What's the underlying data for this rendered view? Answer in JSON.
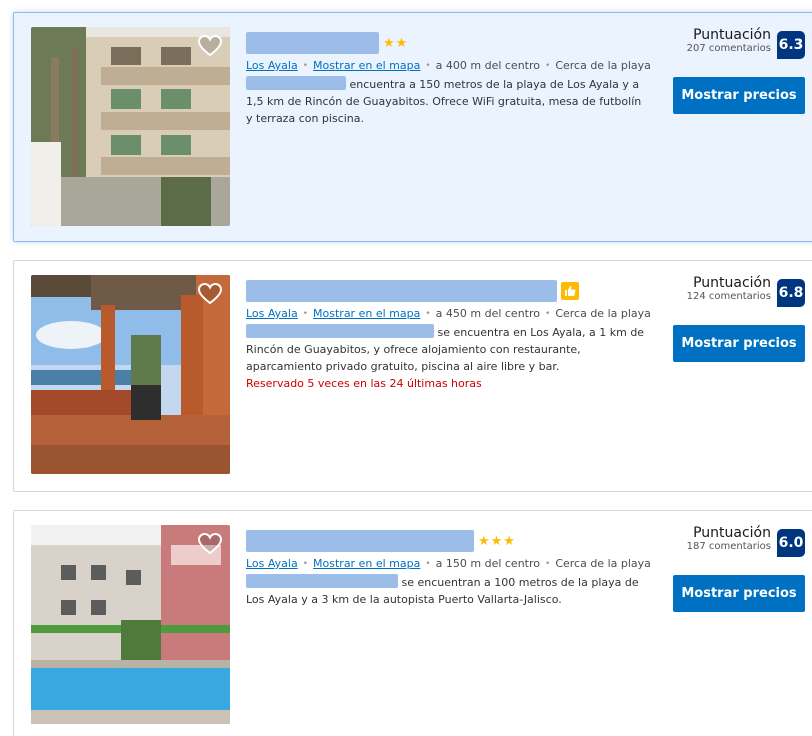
{
  "colors": {
    "link": "#0071c2",
    "score_badge": "#003580",
    "button": "#0071c2",
    "star": "#febb02",
    "urgency": "#cc0000",
    "redaction": "#9dbde9"
  },
  "hotels": [
    {
      "stars": "★★",
      "location_link": "Los Ayala",
      "map_link": "Mostrar en el mapa",
      "distance": "a 400 m del centro",
      "beach": "Cerca de la playa",
      "description": "encuentra a 150 metros de la playa de Los Ayala y a 1,5 km de Rincón de Guayabitos. Ofrece WiFi gratuita, mesa de futbolín y terraza con piscina.",
      "score_label": "Puntuación",
      "review_count": "207 comentarios",
      "score": "6.3",
      "button_label": "Mostrar precios"
    },
    {
      "location_link": "Los Ayala",
      "map_link": "Mostrar en el mapa",
      "distance": "a 450 m del centro",
      "beach": "Cerca de la playa",
      "description": "se encuentra en Los Ayala, a 1 km de Rincón de Guayabitos, y ofrece alojamiento con restaurante, aparcamiento privado gratuito, piscina al aire libre y bar.",
      "urgency": "Reservado 5 veces en las 24 últimas horas",
      "score_label": "Puntuación",
      "review_count": "124 comentarios",
      "score": "6.8",
      "button_label": "Mostrar precios"
    },
    {
      "stars": "★★★",
      "location_link": "Los Ayala",
      "map_link": "Mostrar en el mapa",
      "distance": "a 150 m del centro",
      "beach": "Cerca de la playa",
      "description": "se encuentran a 100 metros de la playa de Los Ayala y a 3 km de la autopista Puerto Vallarta-Jalisco.",
      "score_label": "Puntuación",
      "review_count": "187 comentarios",
      "score": "6.0",
      "button_label": "Mostrar precios"
    }
  ]
}
